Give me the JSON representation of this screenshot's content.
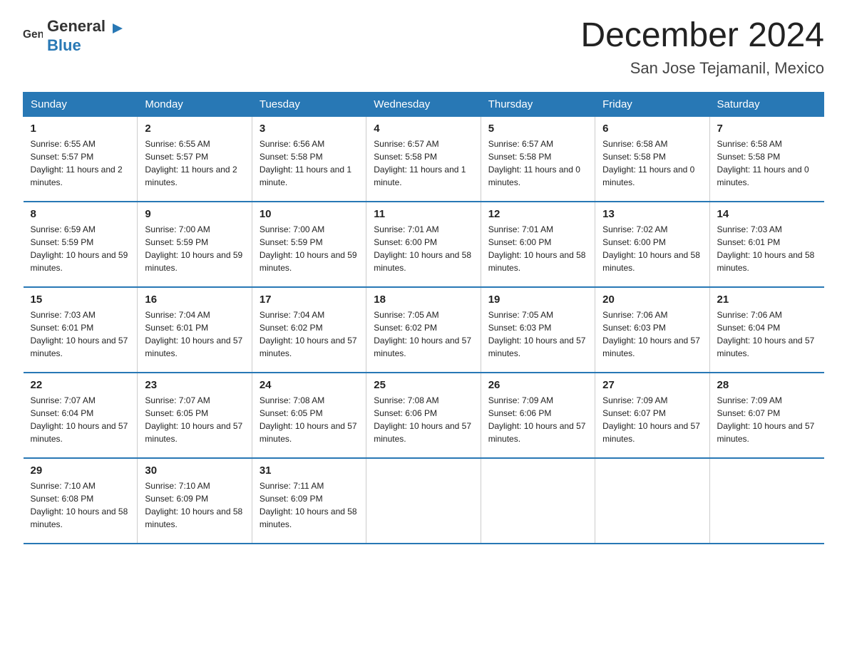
{
  "logo": {
    "text_general": "General",
    "text_blue": "Blue"
  },
  "header": {
    "month": "December 2024",
    "location": "San Jose Tejamanil, Mexico"
  },
  "weekdays": [
    "Sunday",
    "Monday",
    "Tuesday",
    "Wednesday",
    "Thursday",
    "Friday",
    "Saturday"
  ],
  "weeks": [
    [
      {
        "day": "1",
        "sunrise": "6:55 AM",
        "sunset": "5:57 PM",
        "daylight": "11 hours and 2 minutes."
      },
      {
        "day": "2",
        "sunrise": "6:55 AM",
        "sunset": "5:57 PM",
        "daylight": "11 hours and 2 minutes."
      },
      {
        "day": "3",
        "sunrise": "6:56 AM",
        "sunset": "5:58 PM",
        "daylight": "11 hours and 1 minute."
      },
      {
        "day": "4",
        "sunrise": "6:57 AM",
        "sunset": "5:58 PM",
        "daylight": "11 hours and 1 minute."
      },
      {
        "day": "5",
        "sunrise": "6:57 AM",
        "sunset": "5:58 PM",
        "daylight": "11 hours and 0 minutes."
      },
      {
        "day": "6",
        "sunrise": "6:58 AM",
        "sunset": "5:58 PM",
        "daylight": "11 hours and 0 minutes."
      },
      {
        "day": "7",
        "sunrise": "6:58 AM",
        "sunset": "5:58 PM",
        "daylight": "11 hours and 0 minutes."
      }
    ],
    [
      {
        "day": "8",
        "sunrise": "6:59 AM",
        "sunset": "5:59 PM",
        "daylight": "10 hours and 59 minutes."
      },
      {
        "day": "9",
        "sunrise": "7:00 AM",
        "sunset": "5:59 PM",
        "daylight": "10 hours and 59 minutes."
      },
      {
        "day": "10",
        "sunrise": "7:00 AM",
        "sunset": "5:59 PM",
        "daylight": "10 hours and 59 minutes."
      },
      {
        "day": "11",
        "sunrise": "7:01 AM",
        "sunset": "6:00 PM",
        "daylight": "10 hours and 58 minutes."
      },
      {
        "day": "12",
        "sunrise": "7:01 AM",
        "sunset": "6:00 PM",
        "daylight": "10 hours and 58 minutes."
      },
      {
        "day": "13",
        "sunrise": "7:02 AM",
        "sunset": "6:00 PM",
        "daylight": "10 hours and 58 minutes."
      },
      {
        "day": "14",
        "sunrise": "7:03 AM",
        "sunset": "6:01 PM",
        "daylight": "10 hours and 58 minutes."
      }
    ],
    [
      {
        "day": "15",
        "sunrise": "7:03 AM",
        "sunset": "6:01 PM",
        "daylight": "10 hours and 57 minutes."
      },
      {
        "day": "16",
        "sunrise": "7:04 AM",
        "sunset": "6:01 PM",
        "daylight": "10 hours and 57 minutes."
      },
      {
        "day": "17",
        "sunrise": "7:04 AM",
        "sunset": "6:02 PM",
        "daylight": "10 hours and 57 minutes."
      },
      {
        "day": "18",
        "sunrise": "7:05 AM",
        "sunset": "6:02 PM",
        "daylight": "10 hours and 57 minutes."
      },
      {
        "day": "19",
        "sunrise": "7:05 AM",
        "sunset": "6:03 PM",
        "daylight": "10 hours and 57 minutes."
      },
      {
        "day": "20",
        "sunrise": "7:06 AM",
        "sunset": "6:03 PM",
        "daylight": "10 hours and 57 minutes."
      },
      {
        "day": "21",
        "sunrise": "7:06 AM",
        "sunset": "6:04 PM",
        "daylight": "10 hours and 57 minutes."
      }
    ],
    [
      {
        "day": "22",
        "sunrise": "7:07 AM",
        "sunset": "6:04 PM",
        "daylight": "10 hours and 57 minutes."
      },
      {
        "day": "23",
        "sunrise": "7:07 AM",
        "sunset": "6:05 PM",
        "daylight": "10 hours and 57 minutes."
      },
      {
        "day": "24",
        "sunrise": "7:08 AM",
        "sunset": "6:05 PM",
        "daylight": "10 hours and 57 minutes."
      },
      {
        "day": "25",
        "sunrise": "7:08 AM",
        "sunset": "6:06 PM",
        "daylight": "10 hours and 57 minutes."
      },
      {
        "day": "26",
        "sunrise": "7:09 AM",
        "sunset": "6:06 PM",
        "daylight": "10 hours and 57 minutes."
      },
      {
        "day": "27",
        "sunrise": "7:09 AM",
        "sunset": "6:07 PM",
        "daylight": "10 hours and 57 minutes."
      },
      {
        "day": "28",
        "sunrise": "7:09 AM",
        "sunset": "6:07 PM",
        "daylight": "10 hours and 57 minutes."
      }
    ],
    [
      {
        "day": "29",
        "sunrise": "7:10 AM",
        "sunset": "6:08 PM",
        "daylight": "10 hours and 58 minutes."
      },
      {
        "day": "30",
        "sunrise": "7:10 AM",
        "sunset": "6:09 PM",
        "daylight": "10 hours and 58 minutes."
      },
      {
        "day": "31",
        "sunrise": "7:11 AM",
        "sunset": "6:09 PM",
        "daylight": "10 hours and 58 minutes."
      },
      null,
      null,
      null,
      null
    ]
  ],
  "labels": {
    "sunrise": "Sunrise:",
    "sunset": "Sunset:",
    "daylight": "Daylight:"
  }
}
